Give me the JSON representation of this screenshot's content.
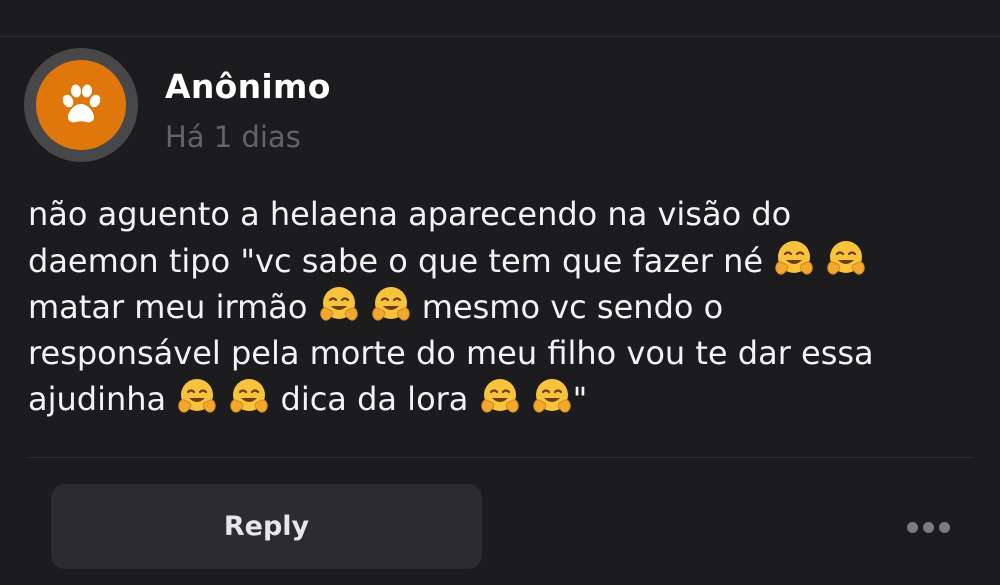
{
  "post": {
    "author": "Anônimo",
    "timestamp": "Há 1 dias",
    "avatar_icon": "paw-icon",
    "avatar_color": "#e0770d",
    "body_segments": [
      {
        "type": "text",
        "value": "não aguento a helaena aparecendo na visão do\ndaemon tipo \"vc sabe o que tem que fazer né "
      },
      {
        "type": "emoji",
        "value": "🤗🤗"
      },
      {
        "type": "text",
        "value": "\nmatar meu irmão "
      },
      {
        "type": "emoji",
        "value": "🤗🤗"
      },
      {
        "type": "text",
        "value": " mesmo vc sendo o\nresponsável pela morte do meu filho vou te dar essa\najudinha "
      },
      {
        "type": "emoji",
        "value": "🤗🤗"
      },
      {
        "type": "text",
        "value": " dica da lora "
      },
      {
        "type": "emoji",
        "value": "🤗🤗"
      },
      {
        "type": "text",
        "value": "\""
      }
    ]
  },
  "actions": {
    "reply_label": "Reply",
    "more_icon": "more-horizontal-icon"
  }
}
